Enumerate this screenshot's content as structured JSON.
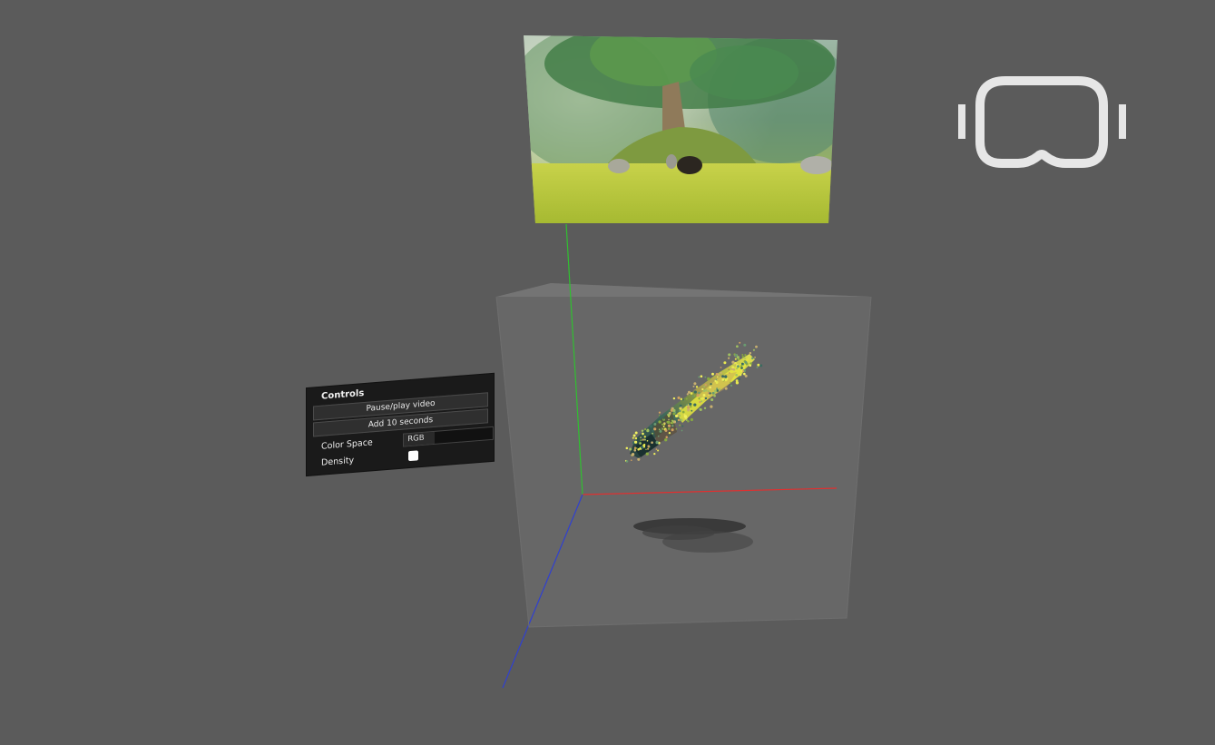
{
  "controls": {
    "title": "Controls",
    "pause_play_label": "Pause/play video",
    "add_seconds_label": "Add 10 seconds",
    "color_space_label": "Color Space",
    "color_space_value": "RGB",
    "density_label": "Density",
    "density_checked": true
  },
  "vr_button": {
    "icon": "vr-headset-icon"
  },
  "colors": {
    "background": "#5b5b5b",
    "box_face": "#6a6a6a",
    "axis_x": "#e03030",
    "axis_y": "#30c030",
    "axis_z": "#3040d0",
    "panel_bg": "#1a1a1a",
    "vr_icon": "#e6e6e6"
  }
}
